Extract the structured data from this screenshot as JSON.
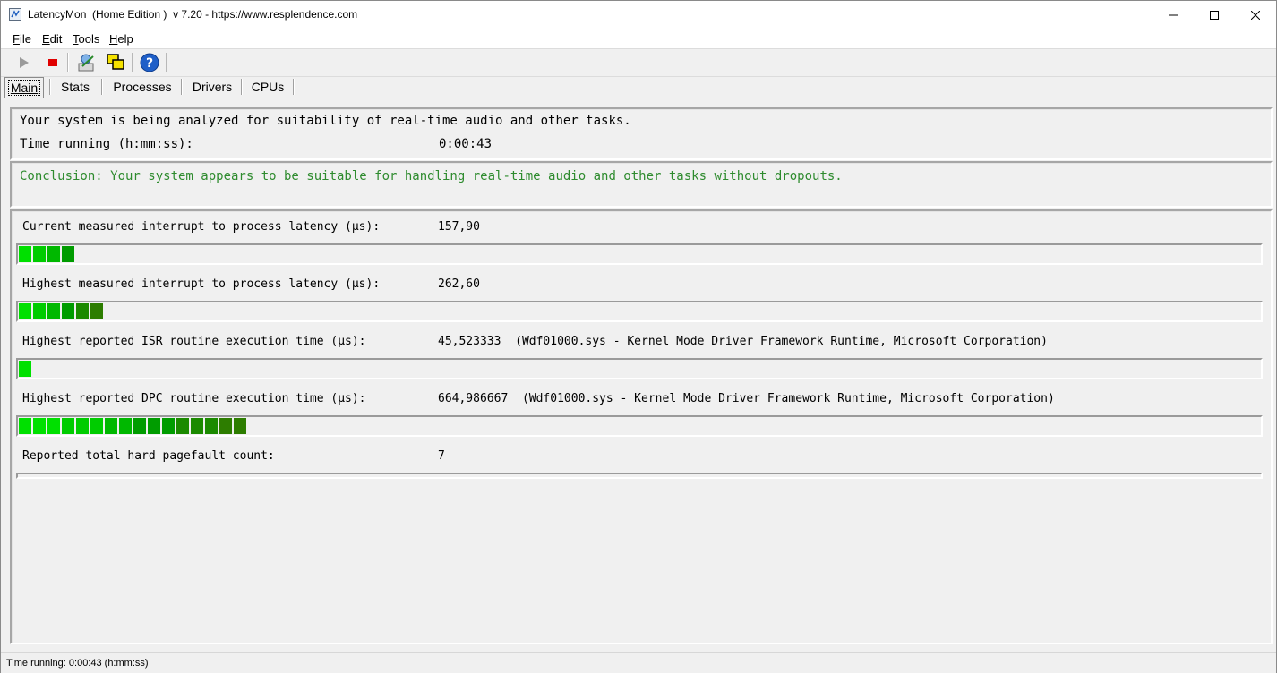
{
  "window": {
    "title": "LatencyMon  (Home Edition )  v 7.20 - https://www.resplendence.com"
  },
  "menu": {
    "items": [
      {
        "label": "File",
        "accel": "F",
        "rest": "ile"
      },
      {
        "label": "Edit",
        "accel": "E",
        "rest": "dit"
      },
      {
        "label": "Tools",
        "accel": "T",
        "rest": "ools"
      },
      {
        "label": "Help",
        "accel": "H",
        "rest": "elp"
      }
    ]
  },
  "toolbar": {
    "icons": [
      "play-icon",
      "stop-icon",
      "report-icon",
      "windows-icon",
      "help-icon"
    ]
  },
  "tabs": [
    {
      "label": "Main",
      "active": true
    },
    {
      "label": "Stats",
      "active": false
    },
    {
      "label": "Processes",
      "active": false
    },
    {
      "label": "Drivers",
      "active": false
    },
    {
      "label": "CPUs",
      "active": false
    }
  ],
  "main": {
    "status_line": "Your system is being analyzed for suitability of real-time audio and other tasks.",
    "time_label": "Time running (h:mm:ss):",
    "time_value": "0:00:43",
    "conclusion": "Conclusion: Your system appears to be suitable for handling real-time audio and other tasks without dropouts.",
    "conclusion_color": "#2e8b2e",
    "measurements": [
      {
        "label": "Current measured interrupt to process latency (µs):",
        "value": "157,90",
        "detail": "",
        "bar_segments": 4
      },
      {
        "label": "Highest measured interrupt to process latency (µs):",
        "value": "262,60",
        "detail": "",
        "bar_segments": 6
      },
      {
        "label": "Highest reported ISR routine execution time (µs):",
        "value": "45,523333",
        "detail": "(Wdf01000.sys - Kernel Mode Driver Framework Runtime, Microsoft Corporation)",
        "bar_segments": 1
      },
      {
        "label": "Highest reported DPC routine execution time (µs):",
        "value": "664,986667",
        "detail": "(Wdf01000.sys - Kernel Mode Driver Framework Runtime, Microsoft Corporation)",
        "bar_segments": 16
      },
      {
        "label": "Reported total hard pagefault count:",
        "value": "7",
        "detail": "",
        "bar_segments": 0
      }
    ],
    "bar_colors": [
      "#00e000",
      "#00cc00",
      "#00b800",
      "#009c00",
      "#1b8a00",
      "#2d7d00"
    ]
  },
  "statusbar": {
    "text": "Time running: 0:00:43  (h:mm:ss)"
  }
}
